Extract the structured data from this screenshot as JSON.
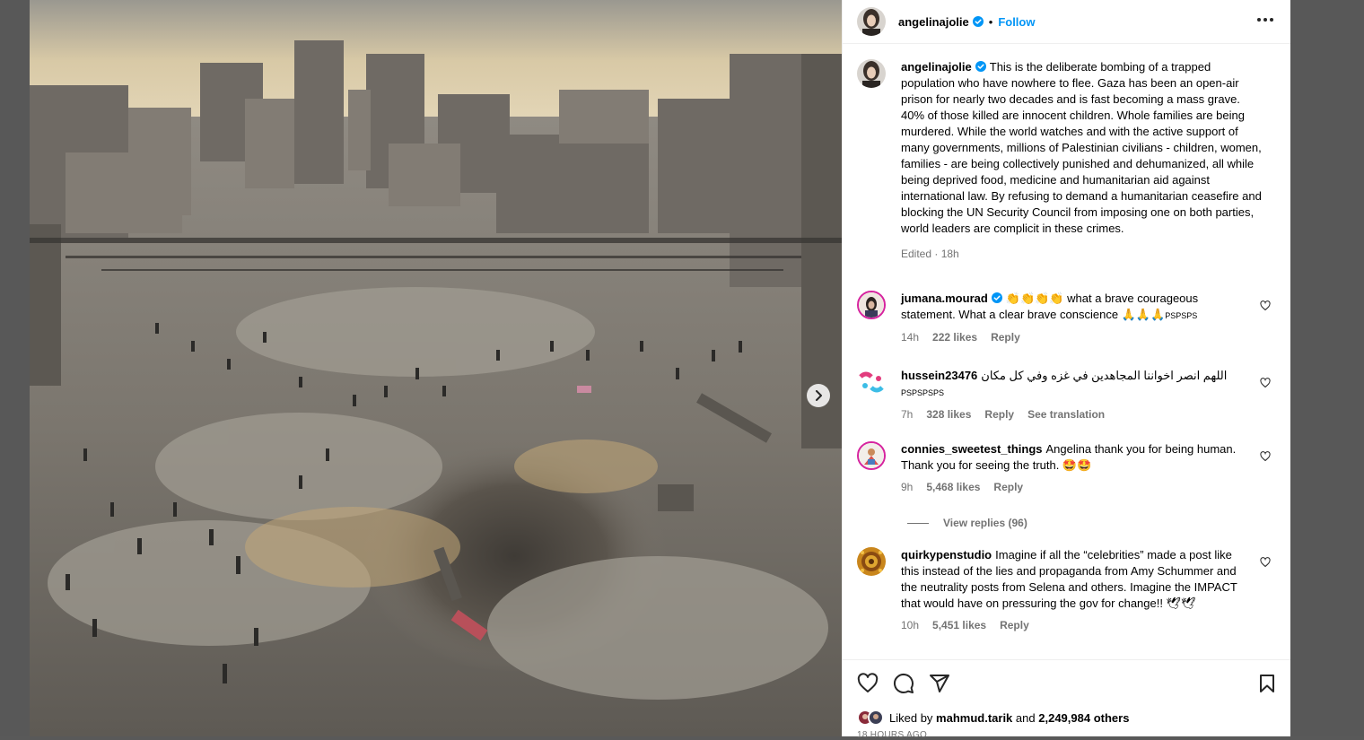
{
  "post": {
    "username": "angelinajolie",
    "follow_label": "Follow",
    "separator": "•",
    "caption": "This is the deliberate bombing of a trapped population who have nowhere to flee. Gaza has been an open-air prison for nearly two decades and is fast becoming a mass grave. 40% of those killed are innocent children. Whole families are being murdered. While the world watches and with the active support of many governments, millions of Palestinian civilians - children, women, families - are being collectively punished and dehumanized, all while being deprived food, medicine and humanitarian aid against international law. By refusing to demand a humanitarian ceasefire and blocking the UN Security Council from imposing one on both parties, world leaders are complicit in these crimes.",
    "caption_meta": "Edited · 18h",
    "liked_by_prefix": "Liked by",
    "liked_by_user": "mahmud.tarik",
    "liked_by_and": "and",
    "liked_count": "2,249,984 others",
    "time_ago": "18 HOURS AGO"
  },
  "comments": [
    {
      "username": "jumana.mourad",
      "text_line1": "👏👏👏👏 what a brave courageous",
      "text_line2": "statement. What a clear brave conscience 🙏🙏🙏",
      "tail": "PSPSPS",
      "time": "14h",
      "likes": "222 likes",
      "reply": "Reply"
    },
    {
      "username": "hussein23476",
      "text": "اللهم انصر اخواننا المجاهدين في غزه وفي كل مكان",
      "tail": "PSPSPSPS",
      "time": "7h",
      "likes": "328 likes",
      "reply": "Reply",
      "translate": "See translation"
    },
    {
      "username": "connies_sweetest_things",
      "text": "Angelina thank you for being human. Thank you for seeing the truth. 🤩🤩",
      "time": "9h",
      "likes": "5,468 likes",
      "reply": "Reply",
      "view_replies": "View replies (96)"
    },
    {
      "username": "quirkypenstudio",
      "text": "Imagine if all the “celebrities” made a post like this instead of the lies and propaganda from Amy Schummer and the neutrality posts from Selena and others. Imagine the IMPACT that would have on pressuring the gov for change!! 🕊🕊",
      "time": "10h",
      "likes": "5,451 likes",
      "reply": "Reply"
    }
  ],
  "icons": {
    "verified": "verified-badge-icon",
    "more": "more-options-icon",
    "like": "heart-icon",
    "comment": "comment-icon",
    "share": "share-icon",
    "save": "bookmark-icon",
    "next": "chevron-right-icon"
  },
  "colors": {
    "accent": "#0095f6",
    "secondary_text": "#737373",
    "border": "#efefef",
    "overlay": "#585858"
  }
}
